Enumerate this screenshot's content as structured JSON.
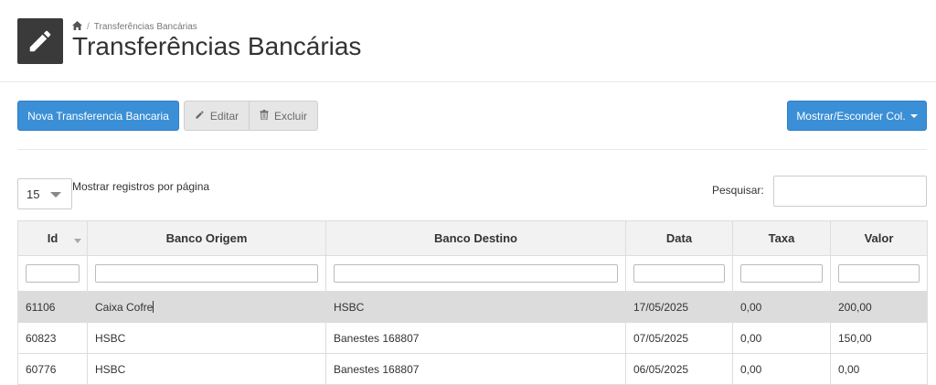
{
  "breadcrumb": {
    "home_icon": "home-icon",
    "current": "Transferências Bancárias",
    "separator": "/"
  },
  "header": {
    "icon": "pencil-icon",
    "title": "Transferências Bancárias"
  },
  "toolbar": {
    "new_label": "Nova Transferencia Bancaria",
    "edit_label": "Editar",
    "delete_label": "Excluir",
    "columns_label": "Mostrar/Esconder Col."
  },
  "table_controls": {
    "page_size": "15",
    "page_size_label": "Mostrar registros por página",
    "search_label": "Pesquisar:",
    "search_value": ""
  },
  "table": {
    "columns": [
      "Id",
      "Banco Origem",
      "Banco Destino",
      "Data",
      "Taxa",
      "Valor"
    ],
    "rows": [
      {
        "id": "61106",
        "origem": "Caixa Cofre",
        "destino": "HSBC",
        "data": "17/05/2025",
        "taxa": "0,00",
        "valor": "200,00"
      },
      {
        "id": "60823",
        "origem": "HSBC",
        "destino": "Banestes 168807",
        "data": "07/05/2025",
        "taxa": "0,00",
        "valor": "150,00"
      },
      {
        "id": "60776",
        "origem": "HSBC",
        "destino": "Banestes 168807",
        "data": "06/05/2025",
        "taxa": "0,00",
        "valor": "0,00"
      }
    ]
  },
  "colors": {
    "primary": "#3a8fd6",
    "header_icon_bg": "#3a3a3a",
    "selected_row": "#dcdcdc"
  }
}
